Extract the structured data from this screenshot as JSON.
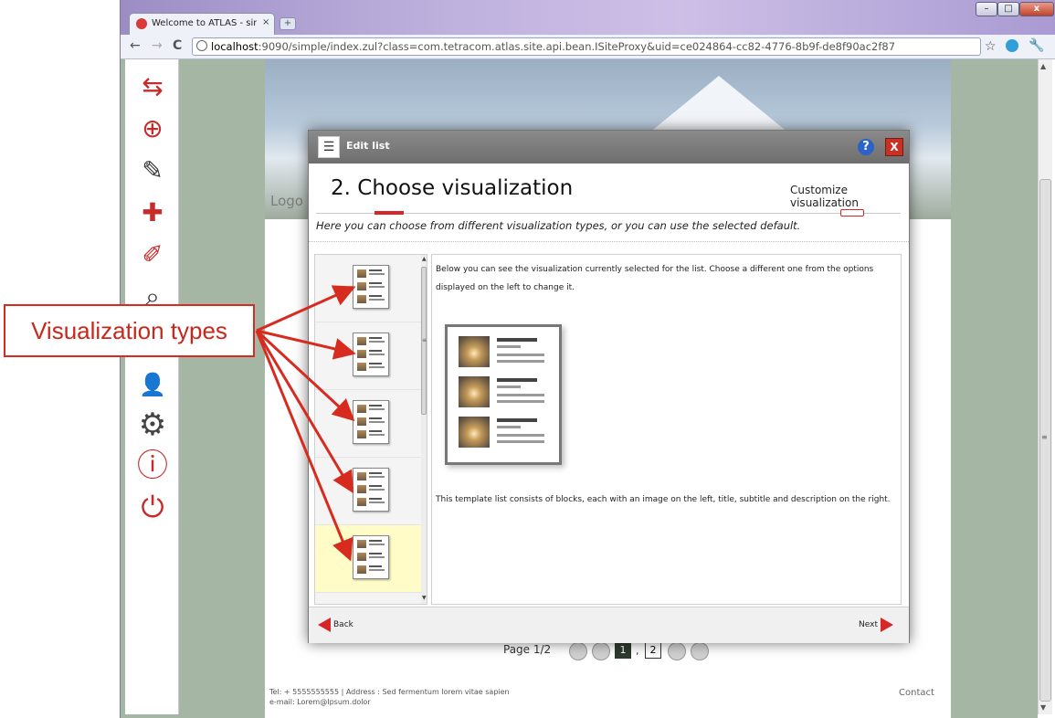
{
  "browser": {
    "tab_title": "Welcome to ATLAS - simpl",
    "tab_close": "×",
    "new_tab": "+",
    "window_min": "–",
    "window_max": "□",
    "window_close": "x",
    "back_glyph": "←",
    "forward_glyph": "→",
    "reload_glyph": "C",
    "url_host": "localhost",
    "url_rest": ":9090/simple/index.zul?class=com.tetracom.atlas.site.api.bean.ISiteProxy&uid=ce024864-cc82-4776-8b9f-de8f90ac2f87",
    "star_glyph": "☆",
    "wrench_glyph": "🔧"
  },
  "page": {
    "logo_text": "Logo",
    "pagination": {
      "label": "Page 1/2",
      "current": "1",
      "separator": ",",
      "next": "2"
    },
    "footer_line1": "Tel: + 5555555555 | Address : Sed fermentum lorem vitae sapien",
    "footer_line2": "e-mail: Lorem@Ipsum.dolor",
    "contact": "Contact"
  },
  "sidebar": {
    "icons": [
      {
        "name": "switch-page-icon",
        "glyph": "⇆"
      },
      {
        "name": "add-page-icon",
        "glyph": "⊕"
      },
      {
        "name": "edit-page-icon",
        "glyph": "✎"
      },
      {
        "name": "add-element-icon",
        "glyph": "✚"
      },
      {
        "name": "edit-element-icon",
        "glyph": "✐"
      },
      {
        "name": "preview-icon",
        "glyph": "⌕"
      },
      {
        "name": "user-icon",
        "glyph": "👤"
      },
      {
        "name": "settings-gear-icon",
        "glyph": "⚙"
      },
      {
        "name": "info-icon",
        "glyph": "ⓘ"
      },
      {
        "name": "power-icon",
        "glyph": "⏻"
      }
    ]
  },
  "dialog": {
    "title": "Edit list",
    "list_glyph": "☰",
    "help_glyph": "?",
    "close_glyph": "X",
    "step_title": "2. Choose visualization",
    "next_step_label": "Customize visualization",
    "description": "Here you can choose from different visualization types, or you can use the selected default.",
    "info_line1": "Below you can see the visualization currently selected for the list. Choose a different one from the options",
    "info_line2": "displayed on the left to change it.",
    "template_description": "This template list consists of blocks, each with an image on the left, title, subtitle and description on the right.",
    "back_label": "Back",
    "next_label": "Next",
    "vis_items": 5,
    "selected_vis_index": 4
  },
  "annotation": {
    "label": "Visualization types"
  },
  "colors": {
    "accent_red": "#d6262a",
    "selected_item_bg": "#fffcc8",
    "dialog_header": "#7a7a7a",
    "callout_text": "#c8281c"
  }
}
